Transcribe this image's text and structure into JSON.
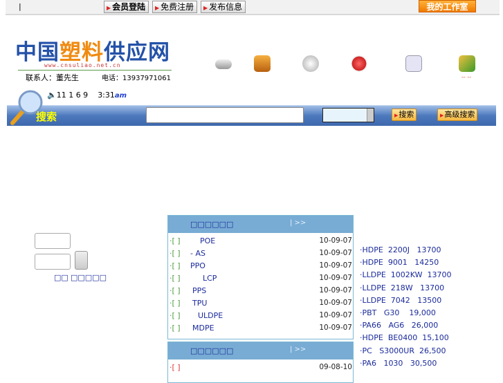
{
  "topbar": {
    "divider": "|",
    "login": "会员登陆",
    "register": "免费注册",
    "publish": "发布信息",
    "studio": "我的工作室"
  },
  "logo": {
    "part1": "中国",
    "part2": "塑料",
    "part3": "供应网",
    "url": "www.cnsuliao.net.cn"
  },
  "contact": {
    "person": "联系人：董先生",
    "phone": "电话：13937971061"
  },
  "nav_icons": [
    "newspaper-icon",
    "briefcase-icon",
    "news-roll-icon",
    "car-icon",
    "calendar-icon",
    "chart-icon"
  ],
  "nav_mark": "-- --",
  "clock": {
    "date": "11 1 6 9",
    "time": "3:31",
    "ampm": "am"
  },
  "search": {
    "label": "搜索",
    "input_value": "",
    "select_value": "",
    "search_button": "搜索",
    "advanced_button": "高级搜索"
  },
  "login": {
    "link1": "□□",
    "link2": "□□□□□"
  },
  "panel1": {
    "title": "□□□□□□",
    "more": "|  >>",
    "rows": [
      {
        "b": "·[ ]",
        "n": "POE",
        "d": "10-09-07",
        "o": 46
      },
      {
        "b": "·[ ]",
        "n": "-    AS",
        "d": "10-09-07",
        "o": 32
      },
      {
        "b": "·[ ]",
        "n": "PPO",
        "d": "10-09-07",
        "o": 32
      },
      {
        "b": "·[ ]",
        "n": "LCP",
        "d": "10-09-07",
        "o": 50
      },
      {
        "b": "·[ ]",
        "n": "PPS",
        "d": "10-09-07",
        "o": 35
      },
      {
        "b": "·[ ]",
        "n": "TPU",
        "d": "10-09-07",
        "o": 35
      },
      {
        "b": "·[ ]",
        "n": "ULDPE",
        "d": "10-09-07",
        "o": 43
      },
      {
        "b": "·[ ]",
        "n": "MDPE",
        "d": "10-09-07",
        "o": 35
      }
    ]
  },
  "panel2": {
    "title": "□□□□□□",
    "more": "|  >>",
    "rows": [
      {
        "b": "·[ ]",
        "n": "",
        "d": "09-08-10"
      }
    ]
  },
  "prices": [
    "·HDPE  2200J   13700",
    "·HDPE  9001   14250",
    "·LLDPE  1002KW  13700",
    "·LLDPE  218W   13700",
    "·LLDPE  7042   13500",
    "·PBT   G30    19,000",
    "·PA66   AG6   26,000",
    "·HDPE  BE0400  15,100",
    "·PC   S3000UR  26,500",
    "·PA6   1030   30,500"
  ]
}
